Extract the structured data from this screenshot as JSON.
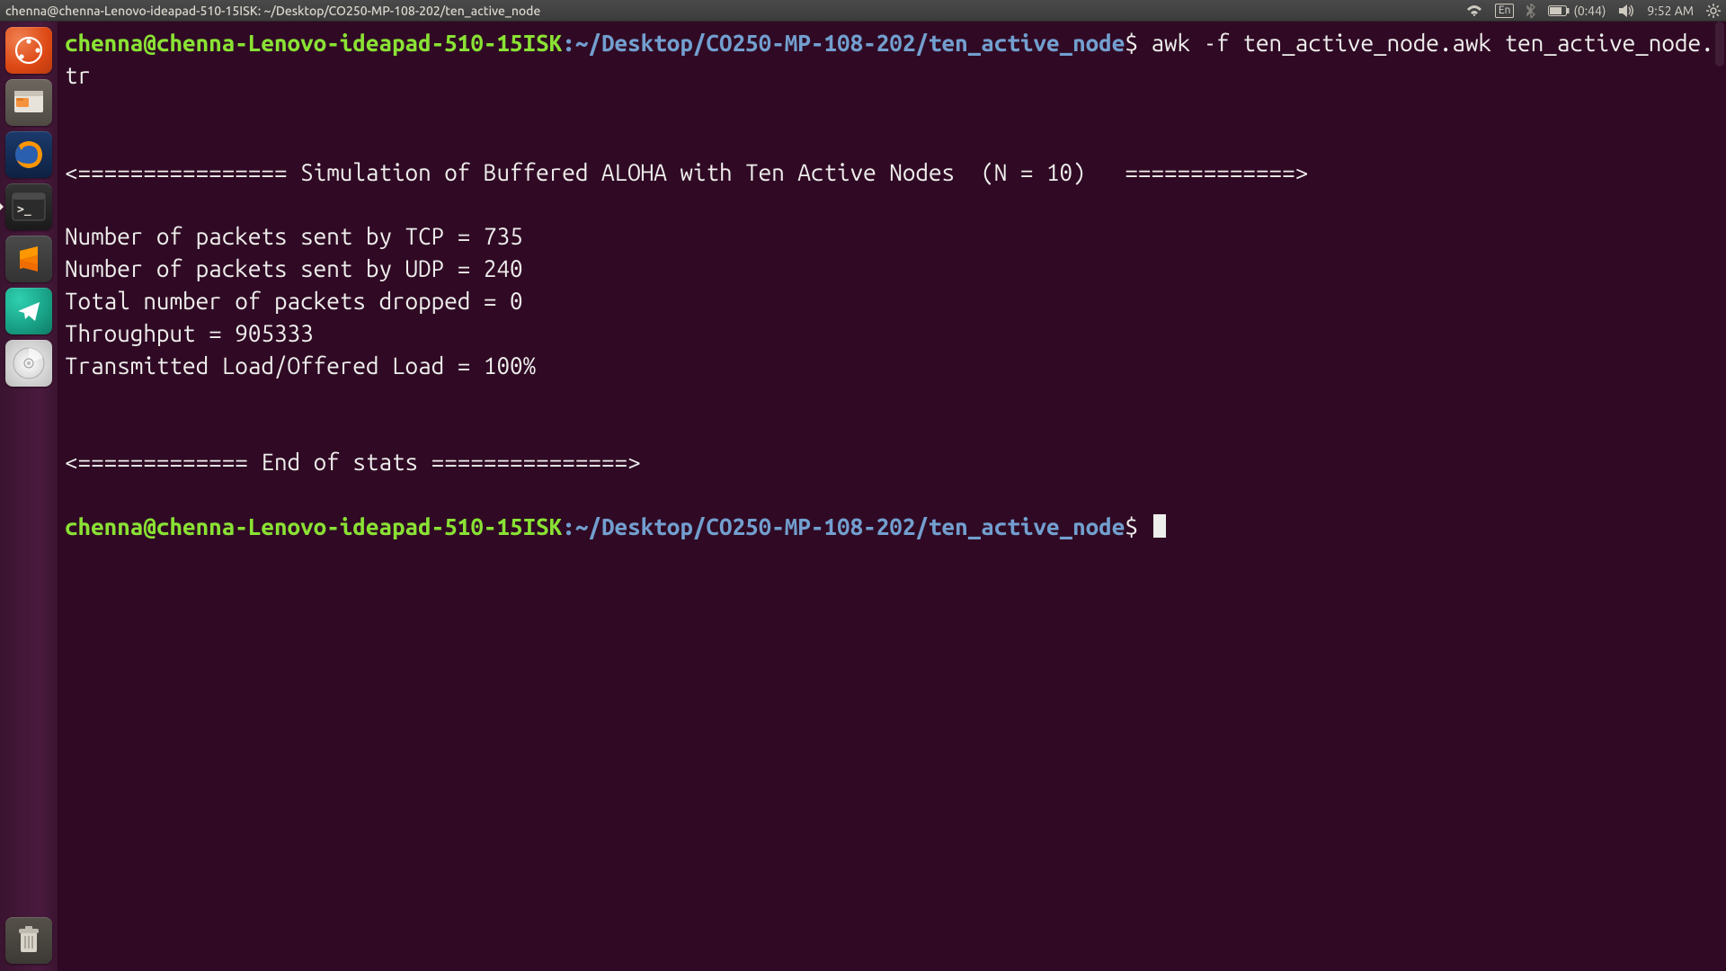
{
  "menubar": {
    "window_title": "chenna@chenna-Lenovo-ideapad-510-15ISK: ~/Desktop/CO250-MP-108-202/ten_active_node",
    "lang": "En",
    "battery_text": "(0:44)",
    "clock": "9:52 AM"
  },
  "launcher": {
    "items": [
      {
        "name": "dash-icon"
      },
      {
        "name": "files-icon"
      },
      {
        "name": "firefox-icon"
      },
      {
        "name": "terminal-icon"
      },
      {
        "name": "sublime-icon"
      },
      {
        "name": "telegram-icon"
      },
      {
        "name": "disc-icon"
      }
    ],
    "trash_name": "trash-icon"
  },
  "terminal": {
    "prompt_user": "chenna@chenna-Lenovo-ideapad-510-15ISK",
    "prompt_sep": ":",
    "prompt_path": "~/Desktop/CO250-MP-108-202/ten_active_node",
    "prompt_dollar": "$",
    "command": "awk -f ten_active_node.awk ten_active_node.tr",
    "output_lines": [
      "",
      "",
      "<================ Simulation of Buffered ALOHA with Ten Active Nodes  (N = 10)   =============>",
      "",
      "Number of packets sent by TCP = 735",
      "Number of packets sent by UDP = 240",
      "Total number of packets dropped = 0",
      "Throughput = 905333",
      "Transmitted Load/Offered Load = 100%",
      "",
      "",
      "<============= End of stats ===============>",
      ""
    ]
  }
}
